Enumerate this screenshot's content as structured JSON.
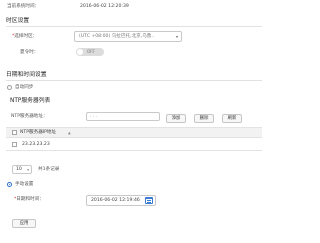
{
  "current_time": {
    "label": "当前系统时间：",
    "value": "2016-06-02 12:20:39"
  },
  "timezone_section": {
    "title": "时区设置",
    "timezone_label": "选择时区：",
    "timezone_value": "(UTC +08:00) 乌拉巴托,北京,乌鲁..",
    "dst_label": "夏令时：",
    "dst_toggle": "OFF"
  },
  "datetime_section": {
    "title": "日期和时间设置",
    "auto_sync_label": "自动同步",
    "ntp_list_title": "NTP服务器列表",
    "ntp_address_label": "NTP服务器地址：",
    "ntp_address_value": "     .       .       .",
    "buttons": {
      "add": "添加",
      "delete": "删除",
      "refresh": "刷新"
    },
    "table": {
      "header": "NTP服务器IP地址",
      "sort_indicator": "▲",
      "rows": [
        "23.23.23.23"
      ]
    },
    "page_size": "10",
    "total_records": "共1条记录",
    "manual_label": "手动设置",
    "date_label": "日期和时间：",
    "date_value": "2016-06-02 12:19:46"
  },
  "apply_button": "应用"
}
